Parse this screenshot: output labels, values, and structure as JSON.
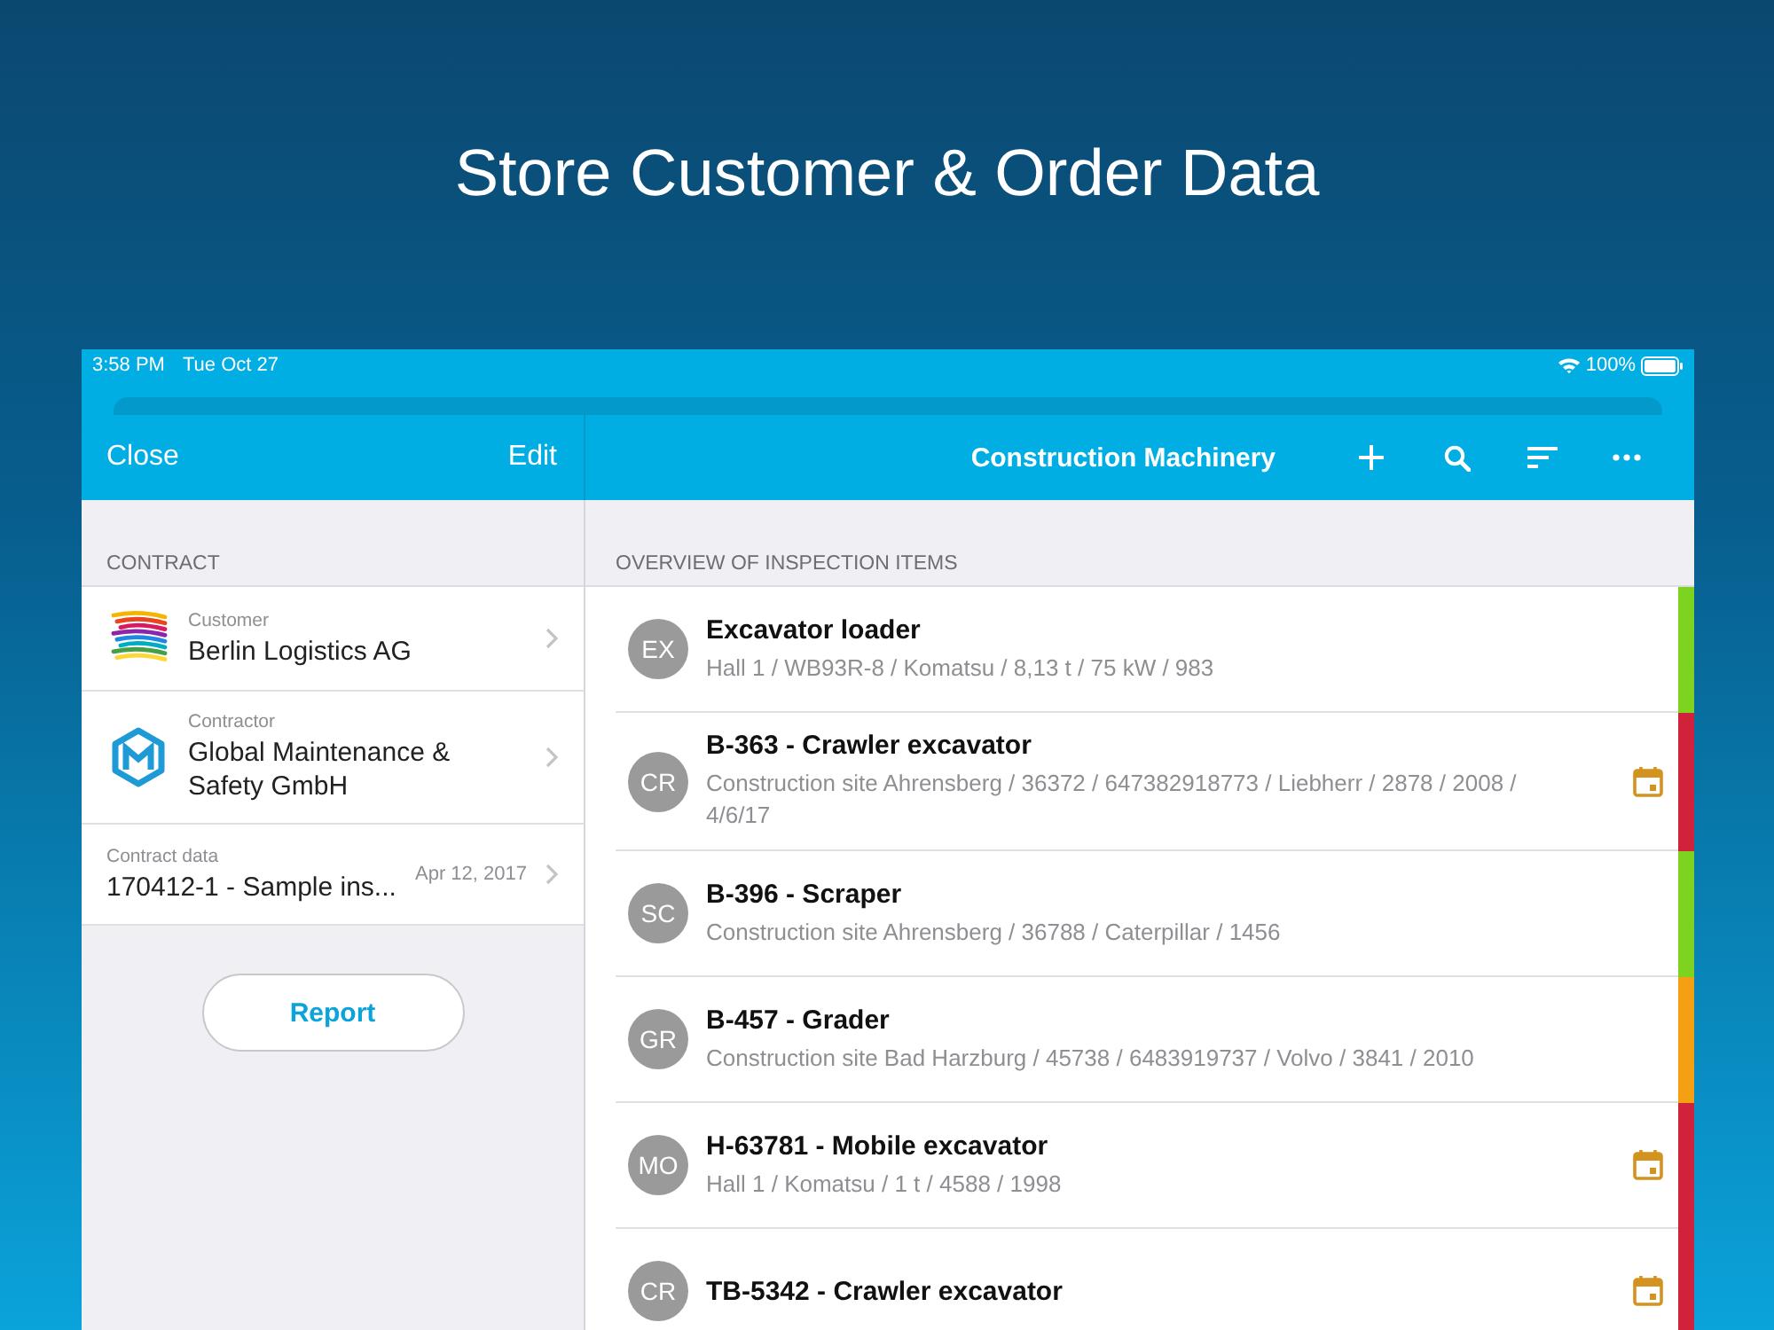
{
  "headline": "Store Customer & Order Data",
  "status_bar": {
    "time": "3:58 PM",
    "date": "Tue Oct 27",
    "battery": "100%"
  },
  "sidebar_nav": {
    "close": "Close",
    "edit": "Edit"
  },
  "main_nav": {
    "title": "Construction Machinery"
  },
  "contract": {
    "header": "CONTRACT",
    "items": [
      {
        "kind": "customer",
        "label": "Customer",
        "value": "Berlin Logistics AG"
      },
      {
        "kind": "contractor",
        "label": "Contractor",
        "value": "Global Maintenance & Safety GmbH"
      },
      {
        "kind": "data",
        "label": "Contract data",
        "value": "170412-1 - Sample ins...",
        "date": "Apr 12, 2017"
      }
    ]
  },
  "report_button": "Report",
  "inspection": {
    "header": "OVERVIEW OF INSPECTION ITEMS",
    "items": [
      {
        "initials": "EX",
        "title": "Excavator loader",
        "details": "Hall 1 / WB93R-8 / Komatsu / 8,13 t / 75 kW / 983",
        "color": "#7ed321",
        "calendar": false
      },
      {
        "initials": "CR",
        "title": "B-363 - Crawler excavator",
        "details": "Construction site Ahrensberg / 36372 / 647382918773 / Liebherr / 2878 / 2008 / 4/6/17",
        "color": "#d0223a",
        "calendar": true
      },
      {
        "initials": "SC",
        "title": "B-396 - Scraper",
        "details": "Construction site Ahrensberg / 36788 / Caterpillar / 1456",
        "color": "#7ed321",
        "calendar": false
      },
      {
        "initials": "GR",
        "title": "B-457 - Grader",
        "details": "Construction site Bad Harzburg / 45738 / 6483919737 / Volvo / 3841 / 2010",
        "color": "#f5a012",
        "calendar": false
      },
      {
        "initials": "MO",
        "title": "H-63781 - Mobile excavator",
        "details": "Hall 1 / Komatsu / 1 t / 4588 / 1998",
        "color": "#d0223a",
        "calendar": true
      },
      {
        "initials": "CR",
        "title": "TB-5342 - Crawler excavator",
        "color": "#d0223a",
        "calendar": true
      }
    ]
  }
}
